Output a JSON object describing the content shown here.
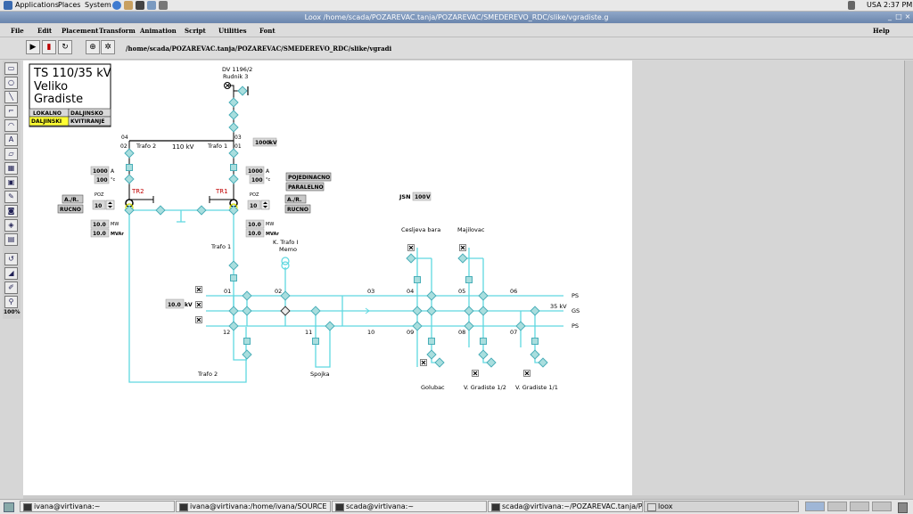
{
  "top_panel": {
    "menus": [
      "Applications",
      "Places",
      "System"
    ],
    "keyboard_layout": "USA",
    "clock": "2:37 PM"
  },
  "window": {
    "title": "Loox /home/scada/POZAREVAC.tanja/POZAREVAC/SMEDEREVO_RDC/slike/vgradiste.g"
  },
  "menubar": {
    "items": [
      "File",
      "Edit",
      "Placement",
      "Transform",
      "Animation",
      "Script",
      "Utilities",
      "Font"
    ],
    "help": "Help"
  },
  "toolbar": {
    "path": "/home/scada/POZAREVAC.tanja/POZAREVAC/SMEDEREVO_RDC/slike/vgradi"
  },
  "palette": {
    "zoom": "100%"
  },
  "diagram": {
    "station_title": "TS 110/35 kV",
    "station_name_1": "Veliko",
    "station_name_2": "Gradiste",
    "mode_local": "LOKALNO",
    "mode_remote": "DALJINSKO",
    "mode_remote_active": "DALJINSKI",
    "mode_ack": "KVITIRANJE",
    "line_name": "DV 1196/2",
    "line_sub": "Rudnik 3",
    "busbar_110": "110 kV",
    "trafo_1_label": "Trafo 1",
    "trafo_2_label": "Trafo 2",
    "node_01": "01",
    "node_02": "02",
    "node_03": "03",
    "node_04": "04",
    "line_voltage_value": "1000",
    "line_voltage_unit": "kV",
    "tr1": {
      "name": "TR1",
      "current": "1000",
      "current_unit": "A",
      "temp": "100",
      "temp_unit": "°c",
      "poz_label": "POZ",
      "poz_value": "10",
      "mw": "10.0",
      "mw_unit": "MW",
      "mvar": "10.0",
      "mvar_unit": "MVAr"
    },
    "tr2": {
      "name": "TR2",
      "current": "1000",
      "current_unit": "A",
      "temp": "100",
      "temp_unit": "°c",
      "poz_label": "POZ",
      "poz_value": "10",
      "mw": "10.0",
      "mw_unit": "MW",
      "mvar": "10.0",
      "mvar_unit": "MVAr"
    },
    "ar_button": "A./R.",
    "rucno_button": "RUCNO",
    "pojedinacno": "POJEDINACNO",
    "paralelno": "PARALELNO",
    "jsn_label": "JSN",
    "jsn_value": "100",
    "jsn_unit": "V",
    "trafo_1_35": "Trafo 1",
    "k_trafo_1": "K. Trafo I",
    "memo": "Memo",
    "busbar_kv_value": "10.0",
    "busbar_kv_unit": "kV",
    "bay_01": "01",
    "bay_02": "02",
    "bay_03": "03",
    "bay_04": "04",
    "bay_05": "05",
    "bay_06": "06",
    "bay_07": "07",
    "bay_08": "08",
    "bay_09": "09",
    "bay_10": "10",
    "bay_11": "11",
    "bay_12": "12",
    "bus_ps_top": "PS",
    "bus_gs": "GS",
    "bus_ps_bottom": "PS",
    "bus_35kv": "35 kV",
    "feeder_cesljeva_bara": "Cesljeva bara",
    "feeder_majilovac": "Majilovac",
    "feeder_golubac": "Golubac",
    "feeder_vg12": "V. Gradiste 1/2",
    "feeder_vg11": "V. Gradiste 1/1",
    "spojka": "Spojka",
    "trafo_2_35": "Trafo 2"
  },
  "taskbar": {
    "tasks": [
      "ivana@virtivana:~",
      "ivana@virtivana:/home/ivana/SOURCE",
      "scada@virtivana:~",
      "scada@virtivana:~/POZAREVAC.tanja/POZ...",
      "loox"
    ]
  },
  "colors": {
    "busbar": "#5fd8e0",
    "breaker": "#a9dede",
    "active_mode": "#ffff33",
    "tr_label": "#c00000",
    "title_bar": "#7991b8"
  }
}
